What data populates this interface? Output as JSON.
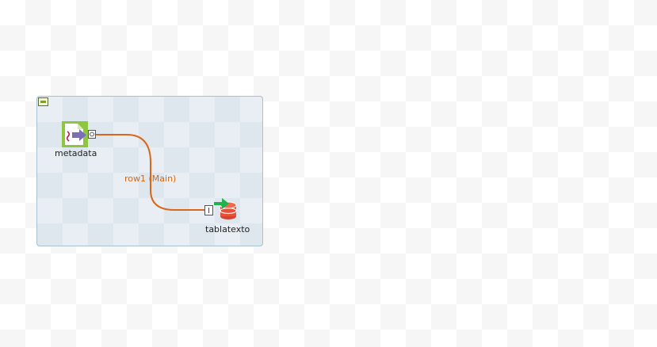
{
  "nodes": {
    "source": {
      "label": "metadata",
      "icon": "file-input-icon",
      "port": "output-connector-icon"
    },
    "target": {
      "label": "tablatexto",
      "icon": "database-output-icon",
      "port": "input-connector-icon"
    }
  },
  "connection": {
    "label": "row1 (Main)",
    "color": "#d9661a"
  },
  "colors": {
    "subjob_fill": "#e8eef3",
    "subjob_border": "#a9c0cf",
    "source_icon_green": "#8dc63f",
    "target_db_red": "#e8503a",
    "target_arrow_green": "#22b14c"
  }
}
